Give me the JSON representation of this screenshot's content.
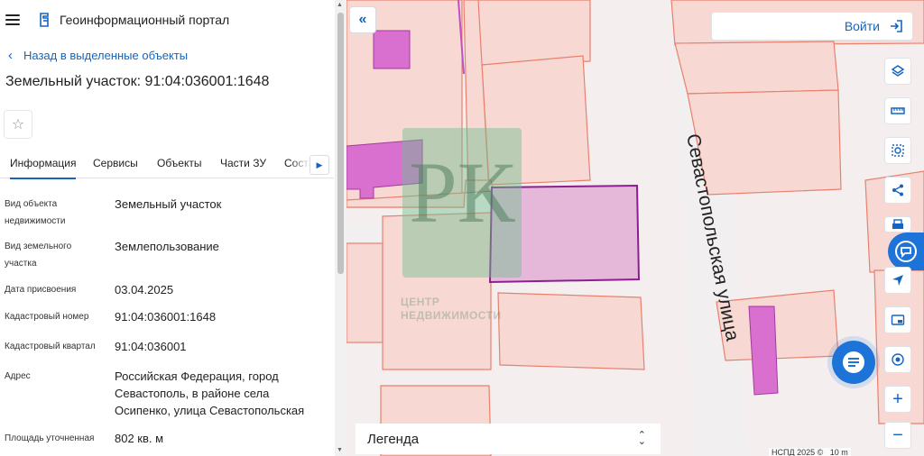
{
  "header": {
    "title": "Геоинформационный портал"
  },
  "nav": {
    "back_label": "Назад в выделенные объекты"
  },
  "parcel": {
    "title": "Земельный участок: 91:04:036001:1648"
  },
  "tabs": [
    {
      "label": "Информация",
      "active": true
    },
    {
      "label": "Сервисы"
    },
    {
      "label": "Объекты"
    },
    {
      "label": "Части ЗУ"
    },
    {
      "label": "Состав"
    }
  ],
  "info": [
    {
      "label": "Вид объекта недвижимости",
      "value": "Земельный участок"
    },
    {
      "label": "Вид земельного участка",
      "value": "Землепользование"
    },
    {
      "label": "Дата присвоения",
      "value": "03.04.2025"
    },
    {
      "label": "Кадастровый номер",
      "value": "91:04:036001:1648"
    },
    {
      "label": "Кадастровый квартал",
      "value": "91:04:036001"
    },
    {
      "label": "Адрес",
      "value": "Российская Федерация, город Севастополь, в районе села Осипенко, улица Севастопольская"
    },
    {
      "label": "Площадь уточненная",
      "value": "802 кв. м"
    }
  ],
  "map": {
    "login_label": "Войти",
    "street_label": "Севастопольская улица",
    "watermark_letters": "РК",
    "watermark_line1": "ЦЕНТР",
    "watermark_line2": "НЕДВИЖИМОСТИ",
    "legend_label": "Легенда",
    "attribution": "НСПД 2025 ©",
    "scale_label": "10 m",
    "tools": [
      "layers-icon",
      "ruler-icon",
      "area-select-icon",
      "share-icon",
      "print-icon",
      "locate-icon",
      "minimap-icon",
      "geo-pin-icon",
      "zoom-in-icon",
      "zoom-out-icon"
    ]
  },
  "colors": {
    "accent": "#1565c0",
    "parcel_fill": "#f8d8d2",
    "parcel_stroke": "#e8806e",
    "building_fill": "#d96fcf",
    "selected_stroke": "#8b1f8f"
  }
}
